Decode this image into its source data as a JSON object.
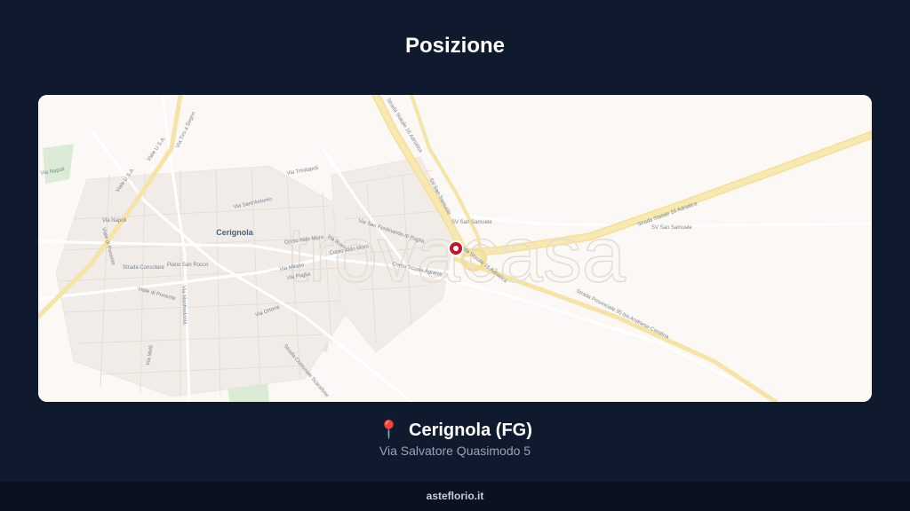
{
  "header": {
    "title": "Posizione"
  },
  "map": {
    "watermark": "trovacasa",
    "city_label": "Cerignola",
    "marker_color": "#c0142a",
    "road_labels": [
      "Strada Statale 16 Adriatica",
      "Strada Statale 16 Adriatica",
      "Strada Statale 16 Adriatica",
      "SV San Samuele",
      "SV San Samuele",
      "SV San Samuele",
      "Corso Scuola Agraria",
      "Strada Provinciale 95 bis Andriese-Coratina",
      "Viale U.S.A.",
      "Viale U.S.A.",
      "Via Napoli",
      "Via Napoli",
      "Viale di Ponente",
      "Viale di Ponente",
      "Via Tiro a Segno",
      "Via Trinitapoli",
      "Via Sant'Antonio",
      "Strada Consolare",
      "Piano San Rocco",
      "Corso Aldo Moro",
      "Corso Aldo Moro",
      "Via Milano",
      "Via Puglia",
      "Via San Ferdinando di Puglia",
      "Via Ruvo",
      "Strada Comunale Scarafone",
      "Via Manfredonia",
      "Via Melfi",
      "Via Ortona"
    ]
  },
  "location": {
    "pin_icon": "round-pushpin-icon",
    "pin_glyph": "📍",
    "city": "Cerignola (FG)",
    "address": "Via Salvatore Quasimodo 5"
  },
  "footer": {
    "brand": "asteflorio.it"
  }
}
